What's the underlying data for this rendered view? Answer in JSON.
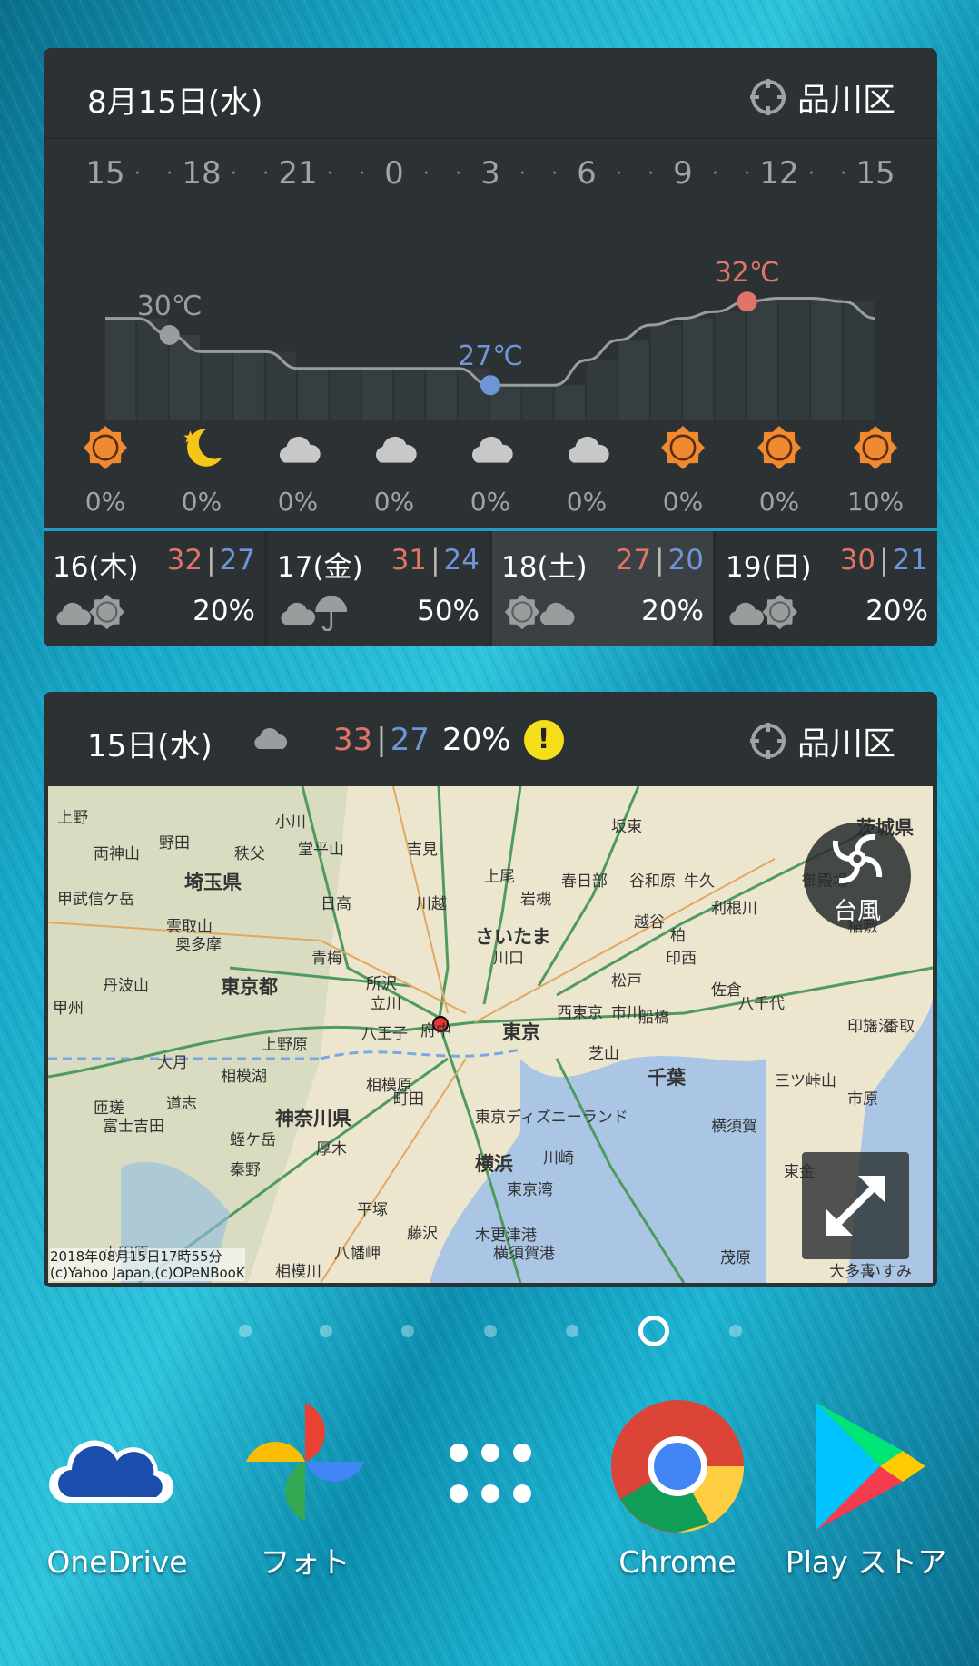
{
  "weather_widget": {
    "date": "8月15日(水)",
    "location": "品川区",
    "hours": [
      "15",
      "18",
      "21",
      "0",
      "3",
      "6",
      "9",
      "12",
      "15"
    ],
    "hourly_temps_c": [
      31,
      31,
      30,
      29,
      29,
      29,
      28,
      28,
      28,
      28,
      28,
      28,
      27,
      27,
      27,
      28.5,
      29.7,
      30.6,
      31,
      31.4,
      32,
      32.2,
      32.2,
      32,
      31
    ],
    "markers": [
      {
        "label": "30℃",
        "hour_index": 2,
        "color": "#9a9d9d"
      },
      {
        "label": "27℃",
        "hour_index": 12,
        "color": "#6e95d8"
      },
      {
        "label": "32℃",
        "hour_index": 20,
        "color": "#e07468"
      }
    ],
    "conditions": [
      {
        "icon": "sun-icon",
        "precip": "0%"
      },
      {
        "icon": "moon-icon",
        "precip": "0%"
      },
      {
        "icon": "cloud-icon",
        "precip": "0%"
      },
      {
        "icon": "cloud-icon",
        "precip": "0%"
      },
      {
        "icon": "cloud-icon",
        "precip": "0%"
      },
      {
        "icon": "cloud-icon",
        "precip": "0%"
      },
      {
        "icon": "sun-icon",
        "precip": "0%"
      },
      {
        "icon": "sun-icon",
        "precip": "0%"
      },
      {
        "icon": "sun-icon",
        "precip": "10%"
      }
    ],
    "daily": [
      {
        "date": "16(木)",
        "high": "32",
        "low": "27",
        "precip": "20%",
        "icon": "cloud-sun-icon"
      },
      {
        "date": "17(金)",
        "high": "31",
        "low": "24",
        "precip": "50%",
        "icon": "cloud-umbrella-icon"
      },
      {
        "date": "18(土)",
        "high": "27",
        "low": "20",
        "precip": "20%",
        "icon": "sun-cloud-icon"
      },
      {
        "date": "19(日)",
        "high": "30",
        "low": "21",
        "precip": "20%",
        "icon": "cloud-sun-icon"
      }
    ],
    "colors": {
      "high": "#e07468",
      "low": "#6e95d8",
      "accent": "#1fa0c0"
    }
  },
  "map_widget": {
    "date": "15日(水)",
    "icon": "cloud-moon-icon",
    "high": "33",
    "low": "27",
    "precip": "20%",
    "alert_symbol": "!",
    "location": "品川区",
    "typhoon_label": "台風",
    "timestamp": "2018年08月15日17時55分",
    "copyright": "(c)Yahoo Japan,(c)OPeNBooK",
    "map_labels": [
      {
        "text": "埼玉県",
        "big": true
      },
      {
        "text": "東京都",
        "big": true
      },
      {
        "text": "神奈川県",
        "big": true
      },
      {
        "text": "東京",
        "big": true
      },
      {
        "text": "横浜",
        "big": true
      },
      {
        "text": "千葉",
        "big": true
      },
      {
        "text": "茨城県",
        "big": true
      },
      {
        "text": "さいたま",
        "big": true
      },
      {
        "text": "上野"
      },
      {
        "text": "小川"
      },
      {
        "text": "両神山"
      },
      {
        "text": "秩父"
      },
      {
        "text": "堂平山"
      },
      {
        "text": "甲武信ケ岳"
      },
      {
        "text": "雲取山"
      },
      {
        "text": "奥多摩"
      },
      {
        "text": "丹波山"
      },
      {
        "text": "甲州"
      },
      {
        "text": "大月"
      },
      {
        "text": "上野原"
      },
      {
        "text": "相模湖"
      },
      {
        "text": "道志"
      },
      {
        "text": "富士吉田"
      },
      {
        "text": "蛭ケ岳"
      },
      {
        "text": "秦野"
      },
      {
        "text": "厚木"
      },
      {
        "text": "平塚"
      },
      {
        "text": "藤沢"
      },
      {
        "text": "町田"
      },
      {
        "text": "相模原"
      },
      {
        "text": "八王子"
      },
      {
        "text": "府中"
      },
      {
        "text": "立川"
      },
      {
        "text": "所沢"
      },
      {
        "text": "青梅"
      },
      {
        "text": "日高"
      },
      {
        "text": "川越"
      },
      {
        "text": "吉見"
      },
      {
        "text": "上尾"
      },
      {
        "text": "岩槻"
      },
      {
        "text": "春日部"
      },
      {
        "text": "坂東"
      },
      {
        "text": "谷和原"
      },
      {
        "text": "牛久"
      },
      {
        "text": "越谷"
      },
      {
        "text": "柏"
      },
      {
        "text": "利根川"
      },
      {
        "text": "印西"
      },
      {
        "text": "川口"
      },
      {
        "text": "松戸"
      },
      {
        "text": "西東京"
      },
      {
        "text": "市川"
      },
      {
        "text": "船橋"
      },
      {
        "text": "八千代"
      },
      {
        "text": "佐倉"
      },
      {
        "text": "印旛沼"
      },
      {
        "text": "芝山"
      },
      {
        "text": "東京ディズニーランド"
      },
      {
        "text": "川崎"
      },
      {
        "text": "東京湾"
      },
      {
        "text": "木更津港"
      },
      {
        "text": "横須賀港"
      },
      {
        "text": "横須賀"
      },
      {
        "text": "市原"
      },
      {
        "text": "東金"
      },
      {
        "text": "茂原"
      },
      {
        "text": "大多喜"
      },
      {
        "text": "いすみ"
      },
      {
        "text": "八幡岬"
      },
      {
        "text": "相模川"
      },
      {
        "text": "小田原"
      },
      {
        "text": "御殿場"
      },
      {
        "text": "稲敷"
      },
      {
        "text": "香取"
      },
      {
        "text": "匝瑳"
      },
      {
        "text": "三ツ峠山"
      },
      {
        "text": "野田"
      }
    ]
  },
  "home": {
    "page_count": 7,
    "current_page": 6,
    "dock": [
      {
        "label": "OneDrive",
        "icon": "onedrive-icon"
      },
      {
        "label": "フォト",
        "icon": "photos-icon"
      },
      {
        "label": "",
        "icon": "app-drawer-icon"
      },
      {
        "label": "Chrome",
        "icon": "chrome-icon"
      },
      {
        "label": "Play ストア",
        "icon": "play-store-icon"
      }
    ]
  }
}
